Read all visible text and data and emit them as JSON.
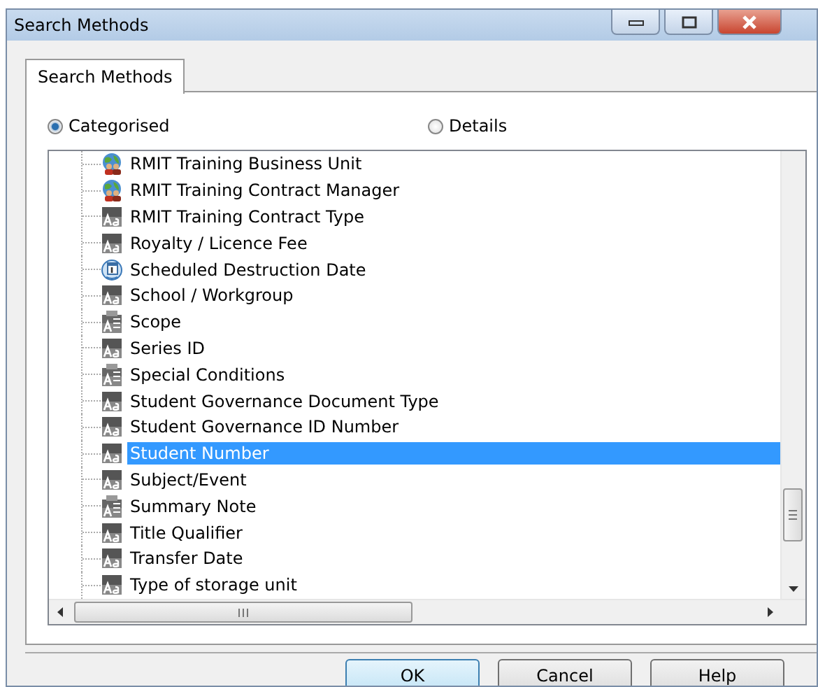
{
  "window": {
    "title": "Search Methods"
  },
  "tabs": [
    {
      "label": "Search Methods",
      "selected": true
    }
  ],
  "view_options": [
    {
      "label": "Categorised",
      "selected": true
    },
    {
      "label": "Details",
      "selected": false
    }
  ],
  "tree": {
    "items": [
      {
        "label": "RMIT Training Business Unit",
        "kind": "people",
        "selected": false
      },
      {
        "label": "RMIT Training Contract Manager",
        "kind": "people",
        "selected": false
      },
      {
        "label": "RMIT Training Contract Type",
        "kind": "text",
        "selected": false
      },
      {
        "label": "Royalty / Licence Fee",
        "kind": "text",
        "selected": false
      },
      {
        "label": "Scheduled Destruction Date",
        "kind": "date",
        "selected": false
      },
      {
        "label": "School / Workgroup",
        "kind": "text",
        "selected": false
      },
      {
        "label": "Scope",
        "kind": "note",
        "selected": false
      },
      {
        "label": "Series ID",
        "kind": "text",
        "selected": false
      },
      {
        "label": "Special Conditions",
        "kind": "note",
        "selected": false
      },
      {
        "label": "Student Governance Document Type",
        "kind": "text",
        "selected": false
      },
      {
        "label": "Student Governance ID Number",
        "kind": "text",
        "selected": false
      },
      {
        "label": "Student Number",
        "kind": "text",
        "selected": true
      },
      {
        "label": "Subject/Event",
        "kind": "text",
        "selected": false
      },
      {
        "label": "Summary Note",
        "kind": "note",
        "selected": false
      },
      {
        "label": "Title Qualifier",
        "kind": "text",
        "selected": false
      },
      {
        "label": "Transfer Date",
        "kind": "text",
        "selected": false
      },
      {
        "label": "Type of storage unit",
        "kind": "text",
        "selected": false
      }
    ]
  },
  "buttons": [
    {
      "label": "OK",
      "default": true
    },
    {
      "label": "Cancel",
      "default": false
    },
    {
      "label": "Help",
      "default": false
    }
  ]
}
